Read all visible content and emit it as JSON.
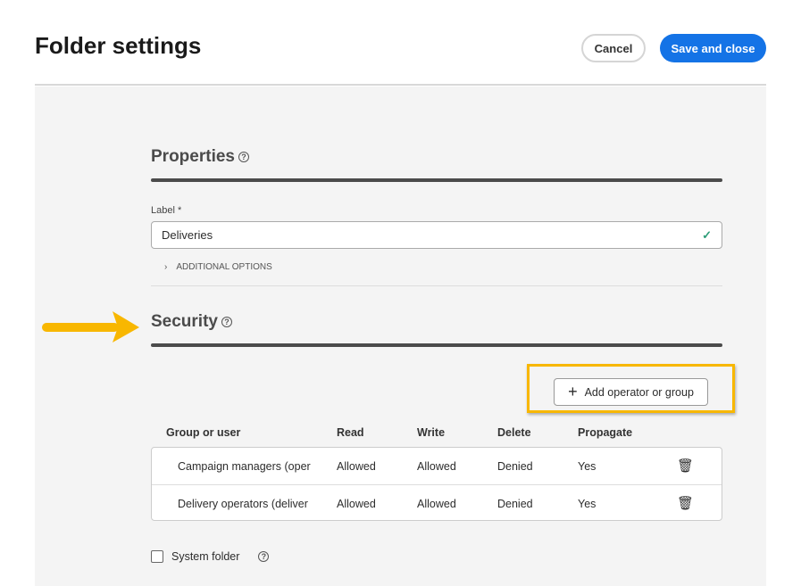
{
  "header": {
    "title": "Folder settings",
    "cancel": "Cancel",
    "save": "Save and close"
  },
  "properties": {
    "heading": "Properties",
    "label": "Label",
    "required": "*",
    "value": "Deliveries",
    "additional": "ADDITIONAL OPTIONS"
  },
  "security": {
    "heading": "Security",
    "add_button": "Add operator or group",
    "columns": [
      "Group or user",
      "Read",
      "Write",
      "Delete",
      "Propagate"
    ],
    "rows": [
      [
        "Campaign managers (oper",
        "Allowed",
        "Allowed",
        "Denied",
        "Yes"
      ],
      [
        "Delivery operators (deliver",
        "Allowed",
        "Allowed",
        "Denied",
        "Yes"
      ]
    ]
  },
  "system_folder": "System folder",
  "accent": "#1473e6",
  "highlight": "#f8b700"
}
